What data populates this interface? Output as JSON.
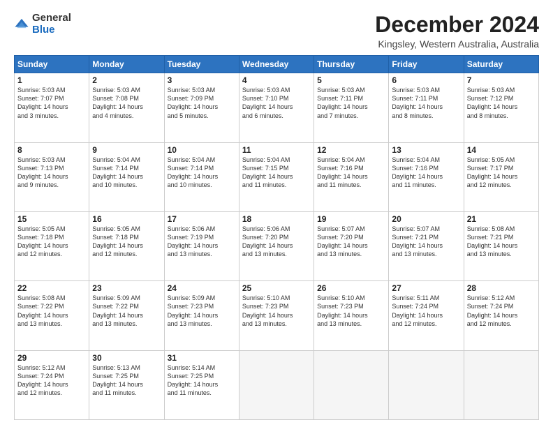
{
  "logo": {
    "general": "General",
    "blue": "Blue"
  },
  "title": "December 2024",
  "location": "Kingsley, Western Australia, Australia",
  "days": [
    "Sunday",
    "Monday",
    "Tuesday",
    "Wednesday",
    "Thursday",
    "Friday",
    "Saturday"
  ],
  "weeks": [
    [
      {
        "day": "1",
        "sunrise": "5:03 AM",
        "sunset": "7:07 PM",
        "daylight": "14 hours and 3 minutes."
      },
      {
        "day": "2",
        "sunrise": "5:03 AM",
        "sunset": "7:08 PM",
        "daylight": "14 hours and 4 minutes."
      },
      {
        "day": "3",
        "sunrise": "5:03 AM",
        "sunset": "7:09 PM",
        "daylight": "14 hours and 5 minutes."
      },
      {
        "day": "4",
        "sunrise": "5:03 AM",
        "sunset": "7:10 PM",
        "daylight": "14 hours and 6 minutes."
      },
      {
        "day": "5",
        "sunrise": "5:03 AM",
        "sunset": "7:11 PM",
        "daylight": "14 hours and 7 minutes."
      },
      {
        "day": "6",
        "sunrise": "5:03 AM",
        "sunset": "7:11 PM",
        "daylight": "14 hours and 8 minutes."
      },
      {
        "day": "7",
        "sunrise": "5:03 AM",
        "sunset": "7:12 PM",
        "daylight": "14 hours and 8 minutes."
      }
    ],
    [
      {
        "day": "8",
        "sunrise": "5:03 AM",
        "sunset": "7:13 PM",
        "daylight": "14 hours and 9 minutes."
      },
      {
        "day": "9",
        "sunrise": "5:04 AM",
        "sunset": "7:14 PM",
        "daylight": "14 hours and 10 minutes."
      },
      {
        "day": "10",
        "sunrise": "5:04 AM",
        "sunset": "7:14 PM",
        "daylight": "14 hours and 10 minutes."
      },
      {
        "day": "11",
        "sunrise": "5:04 AM",
        "sunset": "7:15 PM",
        "daylight": "14 hours and 11 minutes."
      },
      {
        "day": "12",
        "sunrise": "5:04 AM",
        "sunset": "7:16 PM",
        "daylight": "14 hours and 11 minutes."
      },
      {
        "day": "13",
        "sunrise": "5:04 AM",
        "sunset": "7:16 PM",
        "daylight": "14 hours and 11 minutes."
      },
      {
        "day": "14",
        "sunrise": "5:05 AM",
        "sunset": "7:17 PM",
        "daylight": "14 hours and 12 minutes."
      }
    ],
    [
      {
        "day": "15",
        "sunrise": "5:05 AM",
        "sunset": "7:18 PM",
        "daylight": "14 hours and 12 minutes."
      },
      {
        "day": "16",
        "sunrise": "5:05 AM",
        "sunset": "7:18 PM",
        "daylight": "14 hours and 12 minutes."
      },
      {
        "day": "17",
        "sunrise": "5:06 AM",
        "sunset": "7:19 PM",
        "daylight": "14 hours and 13 minutes."
      },
      {
        "day": "18",
        "sunrise": "5:06 AM",
        "sunset": "7:20 PM",
        "daylight": "14 hours and 13 minutes."
      },
      {
        "day": "19",
        "sunrise": "5:07 AM",
        "sunset": "7:20 PM",
        "daylight": "14 hours and 13 minutes."
      },
      {
        "day": "20",
        "sunrise": "5:07 AM",
        "sunset": "7:21 PM",
        "daylight": "14 hours and 13 minutes."
      },
      {
        "day": "21",
        "sunrise": "5:08 AM",
        "sunset": "7:21 PM",
        "daylight": "14 hours and 13 minutes."
      }
    ],
    [
      {
        "day": "22",
        "sunrise": "5:08 AM",
        "sunset": "7:22 PM",
        "daylight": "14 hours and 13 minutes."
      },
      {
        "day": "23",
        "sunrise": "5:09 AM",
        "sunset": "7:22 PM",
        "daylight": "14 hours and 13 minutes."
      },
      {
        "day": "24",
        "sunrise": "5:09 AM",
        "sunset": "7:23 PM",
        "daylight": "14 hours and 13 minutes."
      },
      {
        "day": "25",
        "sunrise": "5:10 AM",
        "sunset": "7:23 PM",
        "daylight": "14 hours and 13 minutes."
      },
      {
        "day": "26",
        "sunrise": "5:10 AM",
        "sunset": "7:23 PM",
        "daylight": "14 hours and 13 minutes."
      },
      {
        "day": "27",
        "sunrise": "5:11 AM",
        "sunset": "7:24 PM",
        "daylight": "14 hours and 12 minutes."
      },
      {
        "day": "28",
        "sunrise": "5:12 AM",
        "sunset": "7:24 PM",
        "daylight": "14 hours and 12 minutes."
      }
    ],
    [
      {
        "day": "29",
        "sunrise": "5:12 AM",
        "sunset": "7:24 PM",
        "daylight": "14 hours and 12 minutes."
      },
      {
        "day": "30",
        "sunrise": "5:13 AM",
        "sunset": "7:25 PM",
        "daylight": "14 hours and 11 minutes."
      },
      {
        "day": "31",
        "sunrise": "5:14 AM",
        "sunset": "7:25 PM",
        "daylight": "14 hours and 11 minutes."
      },
      null,
      null,
      null,
      null
    ]
  ],
  "labels": {
    "sunrise": "Sunrise:",
    "sunset": "Sunset:",
    "daylight": "Daylight hours"
  }
}
